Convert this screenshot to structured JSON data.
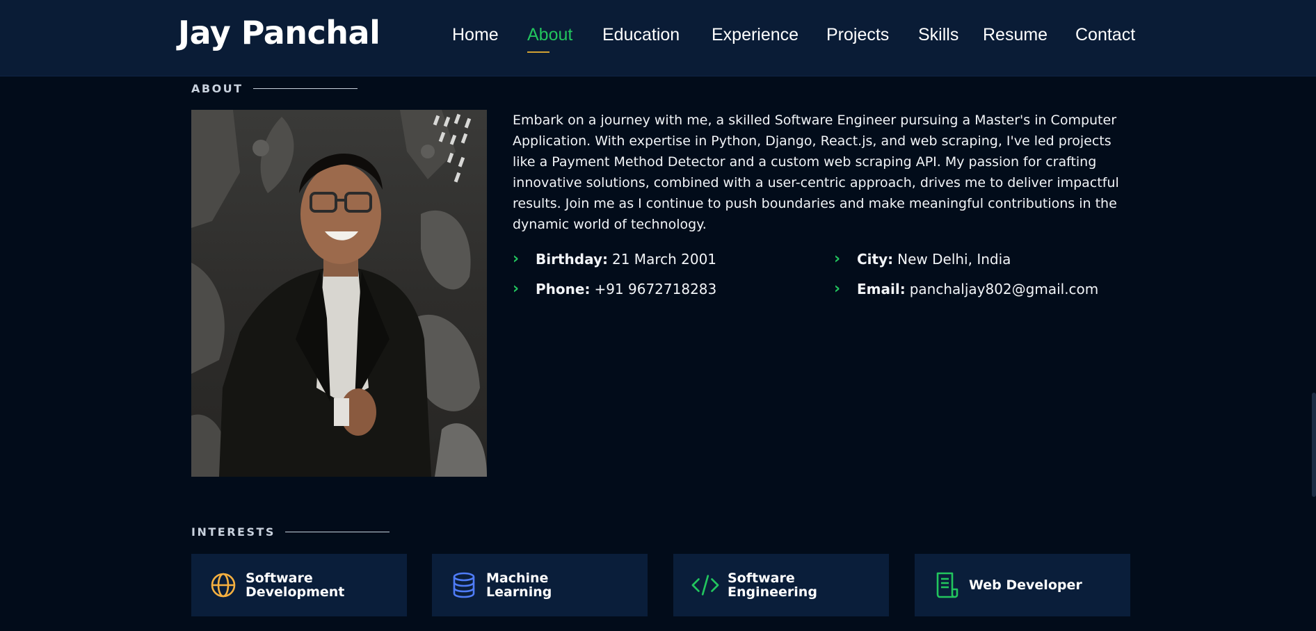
{
  "header": {
    "logo": "Jay Panchal",
    "nav": [
      {
        "label": "Home",
        "active": false
      },
      {
        "label": "About",
        "active": true
      },
      {
        "label": "Education",
        "active": false
      },
      {
        "label": "Experience",
        "active": false
      },
      {
        "label": "Projects",
        "active": false
      },
      {
        "label": "Skills",
        "active": false
      },
      {
        "label": "Resume",
        "active": false
      },
      {
        "label": "Contact",
        "active": false
      }
    ]
  },
  "about": {
    "section_title": "ABOUT",
    "paragraph": "Embark on a journey with me, a skilled Software Engineer pursuing a Master's in Computer Application. With expertise in Python, Django, React.js, and web scraping, I've led projects like a Payment Method Detector and a custom web scraping API. My passion for crafting innovative solutions, combined with a user-centric approach, drives me to deliver impactful results. Join me as I continue to push boundaries and make meaningful contributions in the dynamic world of technology.",
    "info": {
      "birthday_label": "Birthday:",
      "birthday_value": "21 March 2001",
      "phone_label": "Phone:",
      "phone_value": "+91 9672718283",
      "city_label": "City:",
      "city_value": "New Delhi, India",
      "email_label": "Email:",
      "email_value": "panchaljay802@gmail.com"
    }
  },
  "interests": {
    "section_title": "INTERESTS",
    "items": [
      {
        "label": "Software Development",
        "icon": "globe-icon",
        "color": "#f5b040"
      },
      {
        "label": "Machine Learning",
        "icon": "database-icon",
        "color": "#4f7cf7"
      },
      {
        "label": "Software Engineering",
        "icon": "code-icon",
        "color": "#22c55e"
      },
      {
        "label": "Web Developer",
        "icon": "document-icon",
        "color": "#22c55e"
      }
    ]
  },
  "colors": {
    "accent": "#22c55e",
    "underline": "#d1a133",
    "header_bg": "#0a1c36",
    "page_bg": "#020c1a",
    "card_bg": "#0a1e3a"
  }
}
